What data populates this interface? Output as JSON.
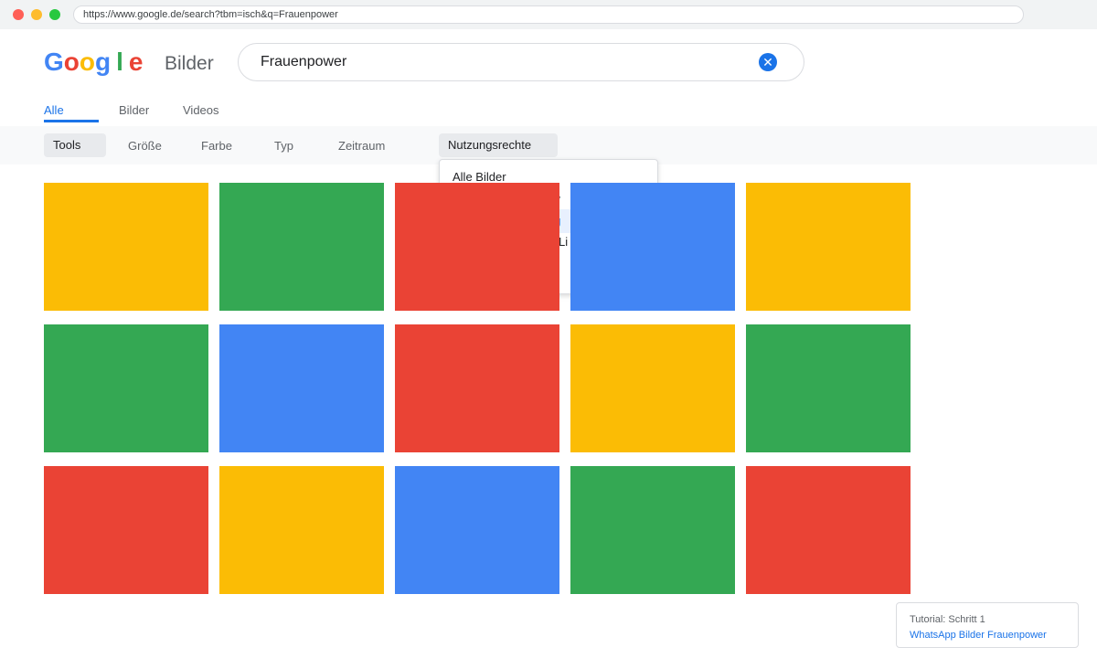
{
  "browser": {
    "url": "https://www.google.de/search?tbm=isch&q=Frauenpower"
  },
  "header": {
    "logo_letters": [
      {
        "char": "G",
        "color": "#4285F4"
      },
      {
        "char": "o",
        "color": "#EA4335"
      },
      {
        "char": "o",
        "color": "#FBBC05"
      },
      {
        "char": "g",
        "color": "#4285F4"
      },
      {
        "char": "l",
        "color": "#34A853"
      },
      {
        "char": "e",
        "color": "#EA4335"
      }
    ],
    "product": "Bilder"
  },
  "search": {
    "value": "Frauenpower"
  },
  "tabs": [
    {
      "label": "Alle",
      "active": true
    },
    {
      "label": "Bilder",
      "active": false
    },
    {
      "label": "Videos",
      "active": false
    }
  ],
  "tools": {
    "tools_label": "Tools",
    "size_label": "Größe",
    "color_label": "Farbe",
    "type_label": "Typ",
    "time_label": "Zeitraum",
    "rights_label": "Nutzungsrechte"
  },
  "dropdown": {
    "items": [
      {
        "label": "Alle Bilder",
        "highlighted": false
      },
      {
        "label": "rw",
        "highlighted": false
      },
      {
        "label": "ng",
        "highlighted": true
      },
      {
        "label": "Li",
        "highlighted": false
      }
    ]
  },
  "results": {
    "tiles": [
      {
        "color": "#FBBC05"
      },
      {
        "color": "#34A853"
      },
      {
        "color": "#EA4335"
      },
      {
        "color": "#4285F4"
      },
      {
        "color": "#FBBC05"
      },
      {
        "color": "#34A853"
      },
      {
        "color": "#4285F4"
      },
      {
        "color": "#EA4335"
      },
      {
        "color": "#FBBC05"
      },
      {
        "color": "#34A853"
      },
      {
        "color": "#EA4335"
      },
      {
        "color": "#FBBC05"
      },
      {
        "color": "#4285F4"
      },
      {
        "color": "#34A853"
      },
      {
        "color": "#EA4335"
      }
    ]
  },
  "tutorial": {
    "title": "Tutorial: Schritt 1",
    "link": "WhatsApp Bilder Frauenpower"
  }
}
